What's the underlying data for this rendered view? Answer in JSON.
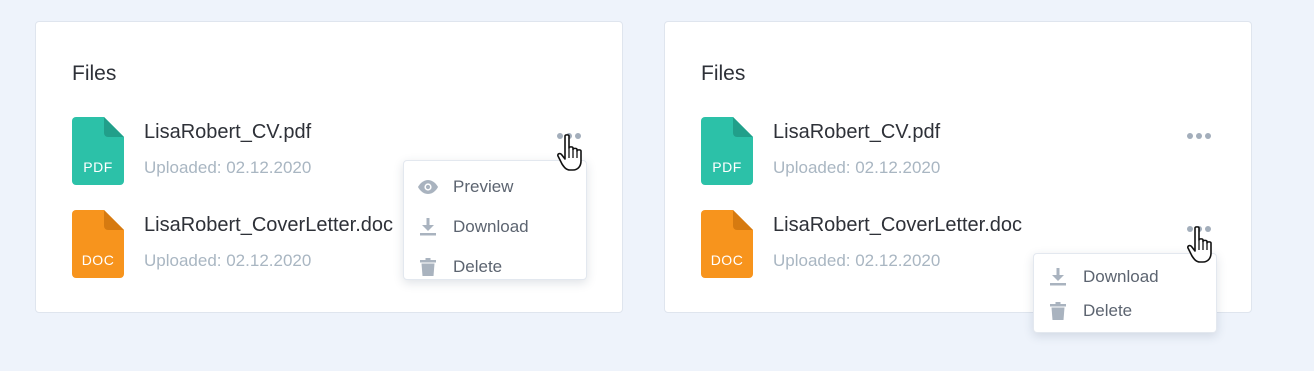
{
  "cards": [
    {
      "title": "Files",
      "files": [
        {
          "name": "LisaRobert_CV.pdf",
          "meta": "Uploaded: 02.12.2020",
          "ext": "PDF"
        },
        {
          "name": "LisaRobert_CoverLetter.doc",
          "meta": "Uploaded: 02.12.2020",
          "ext": "DOC"
        }
      ],
      "menu": [
        {
          "label": "Preview",
          "icon": "eye-icon"
        },
        {
          "label": "Download",
          "icon": "download-icon"
        },
        {
          "label": "Delete",
          "icon": "trash-icon"
        }
      ]
    },
    {
      "title": "Files",
      "files": [
        {
          "name": "LisaRobert_CV.pdf",
          "meta": "Uploaded: 02.12.2020",
          "ext": "PDF"
        },
        {
          "name": "LisaRobert_CoverLetter.doc",
          "meta": "Uploaded: 02.12.2020",
          "ext": "DOC"
        }
      ],
      "menu": [
        {
          "label": "Download",
          "icon": "download-icon"
        },
        {
          "label": "Delete",
          "icon": "trash-icon"
        }
      ]
    }
  ],
  "colors": {
    "pdf": "#2cc1a8",
    "doc": "#f7941d",
    "page_bg": "#eef3fb",
    "muted_text": "#a9b6c2"
  }
}
